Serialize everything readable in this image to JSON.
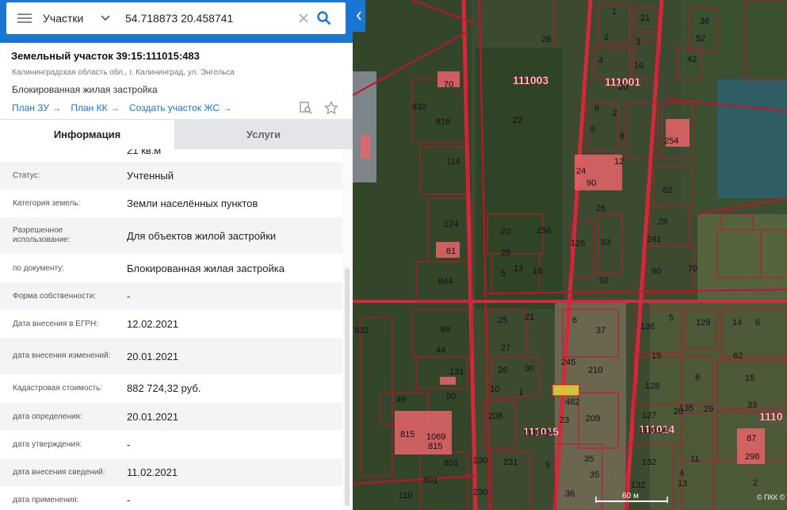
{
  "search": {
    "mode": "Участки",
    "query": "54.718873 20.458741"
  },
  "plot": {
    "title": "Земельный участок 39:15:111015:483",
    "address": "Калининградская область обл., г. Калининград, ул. Энгельса",
    "usage": "Блокированная жилая застройка",
    "links": [
      "План ЗУ →",
      "План КК →",
      "Создать участок ЖС →"
    ]
  },
  "tabs": {
    "info": "Информация",
    "services": "Услуги"
  },
  "info": {
    "partial_value": "21 кв.м",
    "rows": [
      {
        "label": "Статус:",
        "value": "Учтенный"
      },
      {
        "label": "Категория земель:",
        "value": "Земли населённых пунктов"
      },
      {
        "label": "Разрешенное использование:",
        "value": "Для объектов жилой застройки"
      },
      {
        "label": "по документу:",
        "value": "Блокированная жилая застройка"
      },
      {
        "label": "Форма собственности:",
        "value": "-"
      },
      {
        "label": "Дата внесения в ЕГРН:",
        "value": "12.02.2021"
      },
      {
        "label": "дата внесения изменений:",
        "value": "20.01.2021"
      },
      {
        "label": "Кадастровая стоимость:",
        "value": "882 724,32 руб."
      },
      {
        "label": "дата определения:",
        "value": "20.01.2021"
      },
      {
        "label": "дата утверждения:",
        "value": "-"
      },
      {
        "label": "дата внесения сведений:",
        "value": "11.02.2021"
      },
      {
        "label": "дата применения:",
        "value": "-"
      }
    ]
  },
  "map": {
    "quarters": [
      "111003",
      "111001",
      "111015",
      "111014",
      "1110"
    ],
    "plot_labels": [
      "1",
      "21",
      "26",
      "36",
      "2",
      "3",
      "52",
      "4",
      "10",
      "42",
      "70",
      "832",
      "22",
      "20",
      "6",
      "2",
      "5",
      "8",
      "816",
      "254",
      "114",
      "24",
      "90",
      "12",
      "62",
      "26",
      "28",
      "124",
      "20",
      "156",
      "241",
      "93",
      "126",
      "81",
      "28",
      "13",
      "18",
      "60",
      "70",
      "844",
      "5",
      "92",
      "832",
      "25",
      "21",
      "6",
      "37",
      "136",
      "5",
      "129",
      "14",
      "6",
      "68",
      "44",
      "27",
      "245",
      "15",
      "62",
      "131",
      "26",
      "30",
      "210",
      "8",
      "15",
      "49",
      "50",
      "10",
      "1",
      "482",
      "128",
      "135",
      "29",
      "33",
      "208",
      "23",
      "209",
      "127",
      "20",
      "815",
      "1069",
      "815",
      "111015",
      "111014",
      "801",
      "230",
      "231",
      "5",
      "35",
      "132",
      "11",
      "298",
      "801",
      "230",
      "110",
      "36",
      "4",
      "132",
      "13",
      "2",
      "35",
      "87"
    ],
    "scale": "60 м",
    "copyright": "© ПКК ©"
  },
  "colors": {
    "accent": "#1976d2",
    "boundary": "#c8102e",
    "parcel_fill": "#e8646a",
    "selected": "#f2e63a"
  }
}
